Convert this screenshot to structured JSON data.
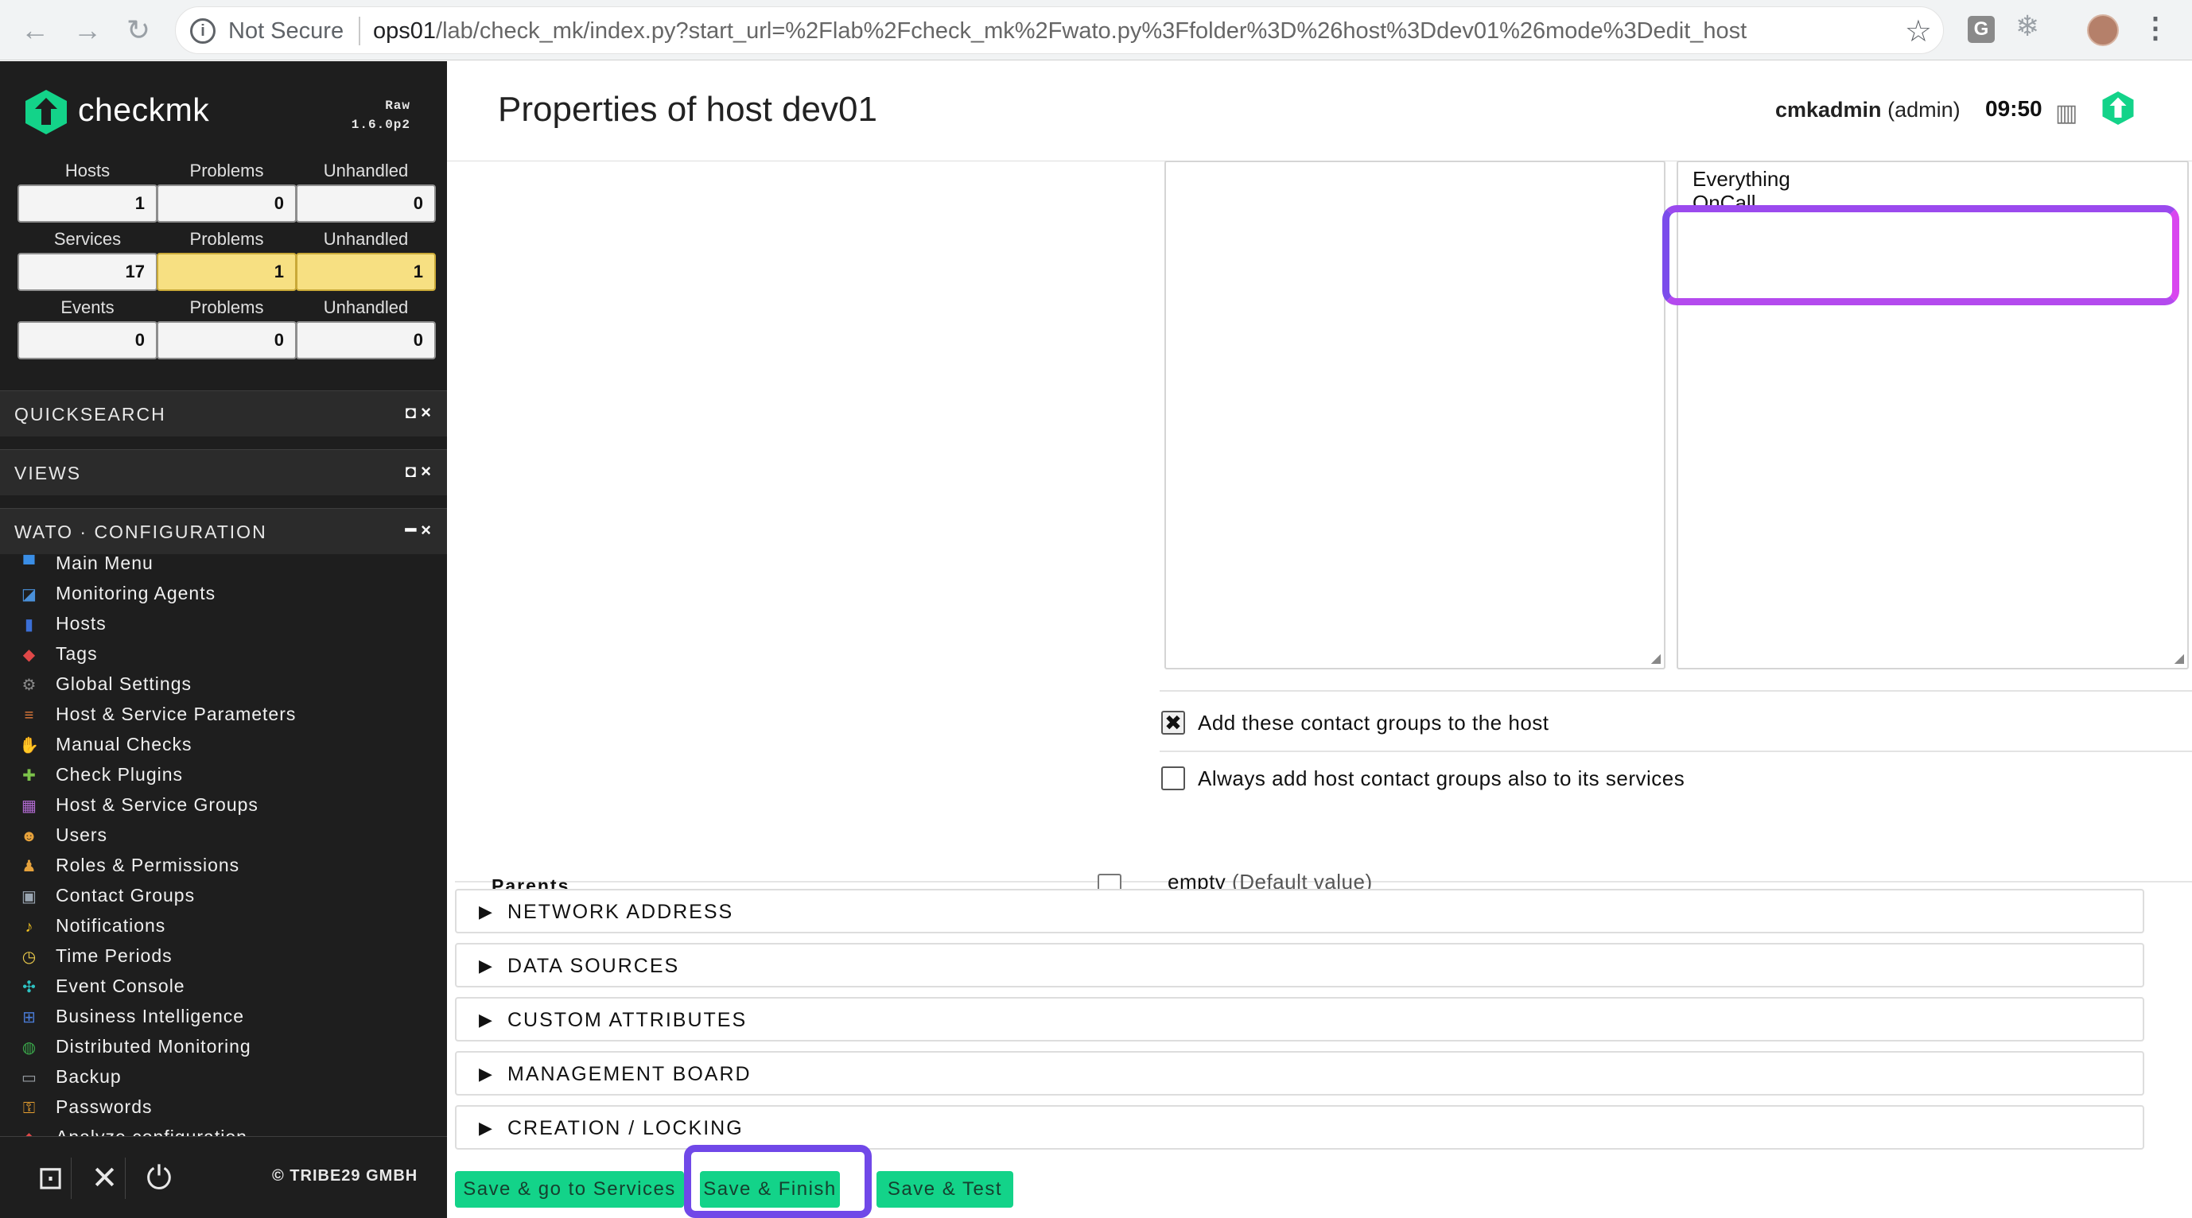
{
  "browser": {
    "security": "Not Secure",
    "url_host": "ops01",
    "url_path": "/lab/check_mk/index.py?start_url=%2Flab%2Fcheck_mk%2Fwato.py%3Ffolder%3D%26host%3Ddev01%26mode%3Dedit_host",
    "extension_letter": "G"
  },
  "sidebar": {
    "logo_text": "checkmk",
    "edition": "Raw",
    "version": "1.6.0p2",
    "stats": {
      "row1": [
        {
          "label": "Hosts",
          "value": "1",
          "warn": false
        },
        {
          "label": "Problems",
          "value": "0",
          "warn": false
        },
        {
          "label": "Unhandled",
          "value": "0",
          "warn": false
        }
      ],
      "row2": [
        {
          "label": "Services",
          "value": "17",
          "warn": false
        },
        {
          "label": "Problems",
          "value": "1",
          "warn": true
        },
        {
          "label": "Unhandled",
          "value": "1",
          "warn": true
        }
      ],
      "row3": [
        {
          "label": "Events",
          "value": "0",
          "warn": false
        },
        {
          "label": "Problems",
          "value": "0",
          "warn": false
        },
        {
          "label": "Unhandled",
          "value": "0",
          "warn": false
        }
      ]
    },
    "snapins": {
      "quicksearch": "QUICKSEARCH",
      "views": "VIEWS",
      "wato": "WATO · CONFIGURATION"
    },
    "wato_items": [
      {
        "label": "Main Menu",
        "icon": "main-menu-icon",
        "color": "#3a8ee6",
        "glyph": "▀"
      },
      {
        "label": "Monitoring Agents",
        "icon": "monitoring-agents-icon",
        "color": "#4a90d9",
        "glyph": "◪"
      },
      {
        "label": "Hosts",
        "icon": "hosts-icon",
        "color": "#3b6fd6",
        "glyph": "▮"
      },
      {
        "label": "Tags",
        "icon": "tags-icon",
        "color": "#e04848",
        "glyph": "◆"
      },
      {
        "label": "Global Settings",
        "icon": "global-settings-icon",
        "color": "#8a8a8a",
        "glyph": "⚙"
      },
      {
        "label": "Host & Service Parameters",
        "icon": "parameters-icon",
        "color": "#e07a3a",
        "glyph": "≡"
      },
      {
        "label": "Manual Checks",
        "icon": "manual-checks-icon",
        "color": "#e8a040",
        "glyph": "✋"
      },
      {
        "label": "Check Plugins",
        "icon": "check-plugins-icon",
        "color": "#7cc24a",
        "glyph": "✚"
      },
      {
        "label": "Host & Service Groups",
        "icon": "groups-icon",
        "color": "#b06ad0",
        "glyph": "▦"
      },
      {
        "label": "Users",
        "icon": "users-icon",
        "color": "#e6a23c",
        "glyph": "☻"
      },
      {
        "label": "Roles & Permissions",
        "icon": "roles-icon",
        "color": "#e6a23c",
        "glyph": "♟"
      },
      {
        "label": "Contact Groups",
        "icon": "contact-groups-icon",
        "color": "#9aa6b2",
        "glyph": "▣"
      },
      {
        "label": "Notifications",
        "icon": "notifications-icon",
        "color": "#f0c020",
        "glyph": "♪"
      },
      {
        "label": "Time Periods",
        "icon": "time-periods-icon",
        "color": "#e8c84a",
        "glyph": "◷"
      },
      {
        "label": "Event Console",
        "icon": "event-console-icon",
        "color": "#2ec4c4",
        "glyph": "✣"
      },
      {
        "label": "Business Intelligence",
        "icon": "business-intelligence-icon",
        "color": "#4a7bd6",
        "glyph": "⊞"
      },
      {
        "label": "Distributed Monitoring",
        "icon": "distributed-monitoring-icon",
        "color": "#3aa64a",
        "glyph": "◍"
      },
      {
        "label": "Backup",
        "icon": "backup-icon",
        "color": "#9aa0a6",
        "glyph": "▭"
      },
      {
        "label": "Passwords",
        "icon": "passwords-icon",
        "color": "#e8a030",
        "glyph": "⚿"
      },
      {
        "label": "Analyze configuration",
        "icon": "analyze-icon",
        "color": "#e04848",
        "glyph": "◆"
      }
    ],
    "footer_copyright": "© TRIBE29 GMBH"
  },
  "header": {
    "title": "Properties of host dev01",
    "user": "cmkadmin",
    "role": "(admin)",
    "time": "09:50"
  },
  "form": {
    "selected_groups": [
      "Everything",
      "OnCall"
    ],
    "add_contact_groups_label": "Add these contact groups to the host",
    "add_contact_groups_checked": true,
    "always_add_label": "Always add host contact groups also to its services",
    "always_add_checked": false,
    "parents_label": "Parents",
    "parents_value": "empty",
    "parents_default": "(Default value)"
  },
  "sections": [
    "NETWORK ADDRESS",
    "DATA SOURCES",
    "CUSTOM ATTRIBUTES",
    "MANAGEMENT BOARD",
    "CREATION / LOCKING"
  ],
  "buttons": {
    "save_services": "Save & go to Services",
    "save_finish": "Save & Finish",
    "save_test": "Save & Test"
  },
  "colors": {
    "accent_green": "#13d389",
    "highlight_purple": "#7048e8",
    "highlight_pink": "#d946ef",
    "warn_yellow": "#f7e082"
  }
}
